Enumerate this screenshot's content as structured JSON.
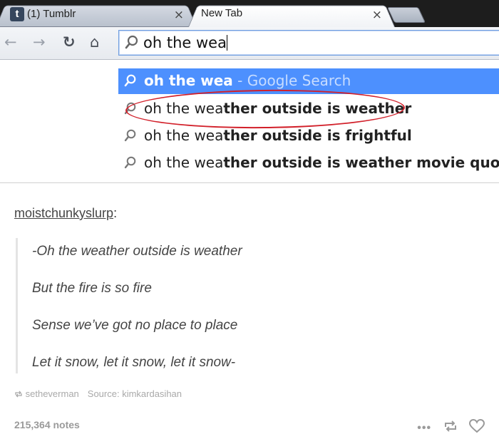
{
  "browser": {
    "tabs": [
      {
        "title": "(1) Tumblr",
        "favicon": "t"
      },
      {
        "title": "New Tab"
      }
    ],
    "tab_close_glyph": "×",
    "omnibox": {
      "value": "oh the wea"
    },
    "suggestions": [
      {
        "typed": "oh the wea",
        "completion": "",
        "hint": " - Google Search",
        "selected": true
      },
      {
        "typed": "oh the wea",
        "completion": "ther outside is weather",
        "hint": "",
        "selected": false
      },
      {
        "typed": "oh the wea",
        "completion": "ther outside is frightful",
        "hint": "",
        "selected": false
      },
      {
        "typed": "oh the wea",
        "completion": "ther outside is weather movie quote",
        "hint": "",
        "selected": false
      }
    ],
    "colors": {
      "selected_row": "#4d90fe",
      "annotation_circle": "#d2202a",
      "tab_strip": "#1d1d1d"
    }
  },
  "post": {
    "author": "moistchunkyslurp",
    "author_suffix": ":",
    "quote_lines": [
      "-Oh the weather outside is weather",
      "But the fire is so fire",
      "Sense we’ve got no place to place",
      "Let it snow, let it snow, let it snow-"
    ],
    "reblogged_from": "setheverman",
    "source": "Source: kimkardasihan",
    "notes": "215,364 notes",
    "icons": [
      "reblog-small-icon",
      "more-icon",
      "reblog-icon",
      "heart-icon"
    ]
  }
}
